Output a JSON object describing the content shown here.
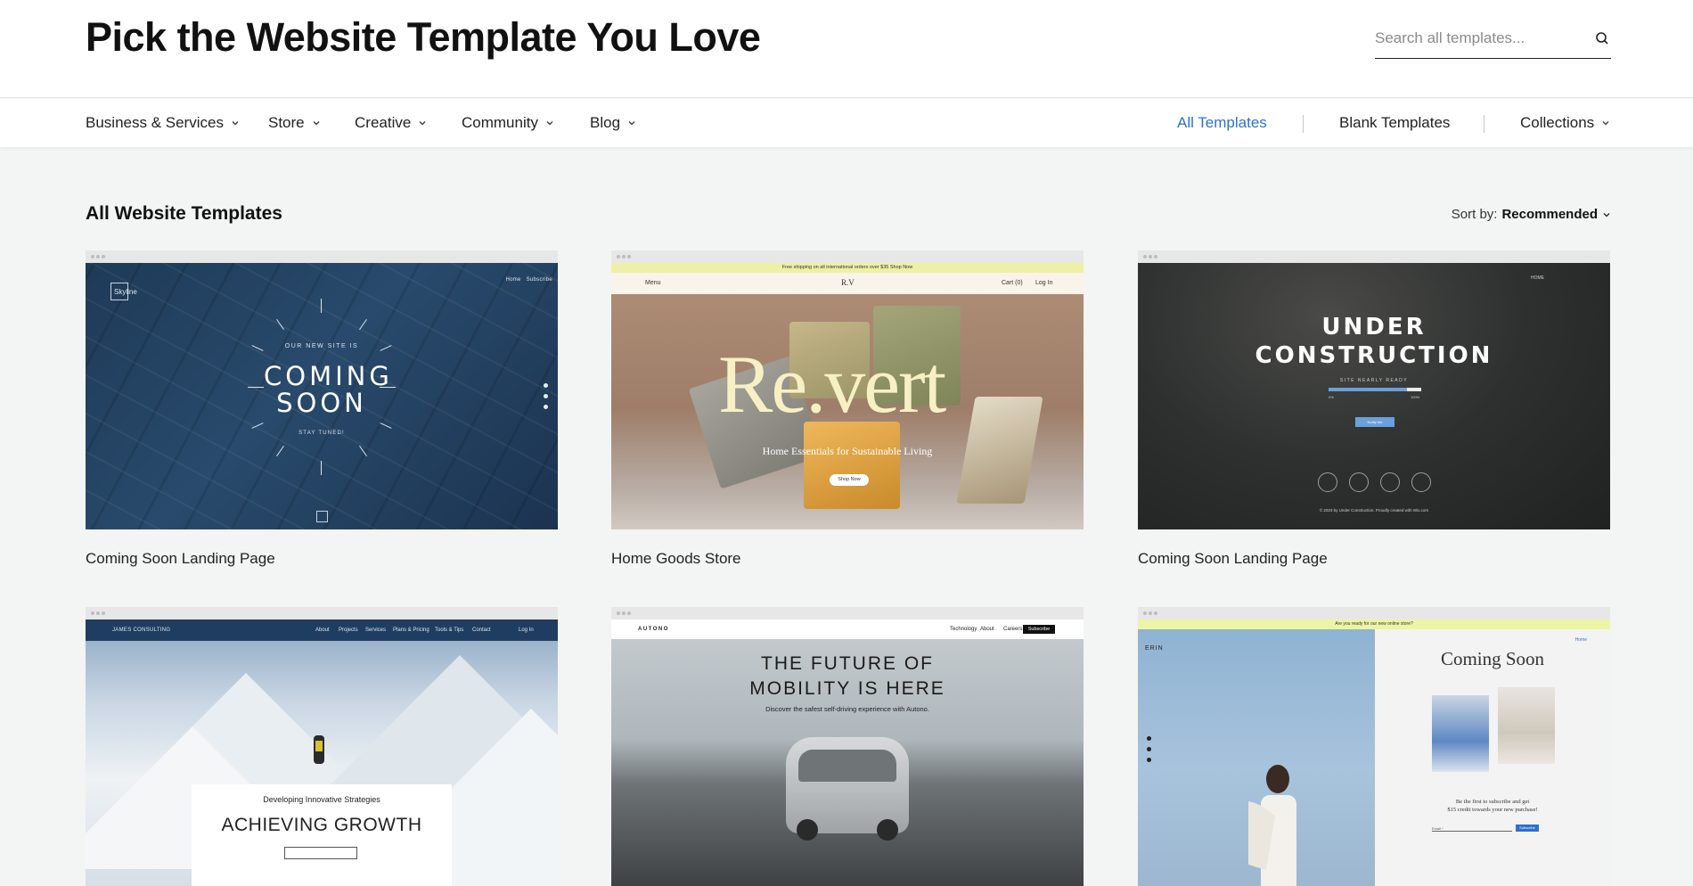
{
  "header": {
    "title": "Pick the Website Template You Love",
    "search_placeholder": "Search all templates..."
  },
  "nav": {
    "categories": [
      "Business & Services",
      "Store",
      "Creative",
      "Community",
      "Blog"
    ],
    "right": {
      "all_templates": "All Templates",
      "blank_templates": "Blank Templates",
      "collections": "Collections"
    },
    "active": "All Templates"
  },
  "section": {
    "title": "All Website Templates",
    "sort_label": "Sort by:",
    "sort_value": "Recommended"
  },
  "cards": [
    {
      "caption": "Coming Soon Landing Page",
      "preview": {
        "logo": "Skyline",
        "nav_home": "Home",
        "nav_subscribe": "Subscribe",
        "pre": "OUR NEW SITE IS",
        "headline": "COMING SOON",
        "tag": "STAY TUNED!"
      }
    },
    {
      "caption": "Home Goods Store",
      "preview": {
        "ship_text": "Free shipping on all international orders over $35 Shop Now",
        "menu": "Menu",
        "logo": "R.V",
        "cart": "Cart (0)",
        "login": "Log In",
        "brand": "Re.vert",
        "sub": "Home Essentials for Sustainable Living",
        "button": "Shop Now"
      }
    },
    {
      "caption": "Coming Soon Landing Page",
      "preview": {
        "home": "HOME",
        "headline_1": "UNDER",
        "headline_2": "CONSTRUCTION",
        "nearly": "SITE NEARLY READY",
        "progress": 0.85,
        "min": "0%",
        "max": "100%",
        "notify": "Notify Me",
        "copyright": "© 2023 by Under Construction. Proudly created with Wix.com"
      }
    },
    {
      "caption": "",
      "preview": {
        "brand": "JAMES CONSULTING",
        "links": [
          "About",
          "Projects",
          "Services",
          "Plans & Pricing",
          "Tools & Tips",
          "Contact"
        ],
        "login": "Log In",
        "dev": "Developing Innovative Strategies",
        "headline": "ACHIEVING GROWTH"
      }
    },
    {
      "caption": "",
      "preview": {
        "brand": "AUTONO",
        "links": [
          "Technology",
          "About",
          "Careers"
        ],
        "subscribe": "Subscribe",
        "headline_1": "THE FUTURE OF",
        "headline_2": "MOBILITY IS HERE",
        "discover": "Discover the safest self-driving experience with Autono."
      }
    },
    {
      "caption": "",
      "preview": {
        "ship_text": "Are you ready for our new online store?",
        "brand": "ERIN",
        "home": "Home",
        "headline": "Coming Soon",
        "blurb_1": "Be the first to subscribe and get",
        "blurb_2": "$15 credit towards your new purchase!",
        "email": "Email *",
        "button": "Subscribe"
      }
    }
  ],
  "colors": {
    "accent": "#2f6fd1",
    "page_bg": "#f3f4f4"
  }
}
